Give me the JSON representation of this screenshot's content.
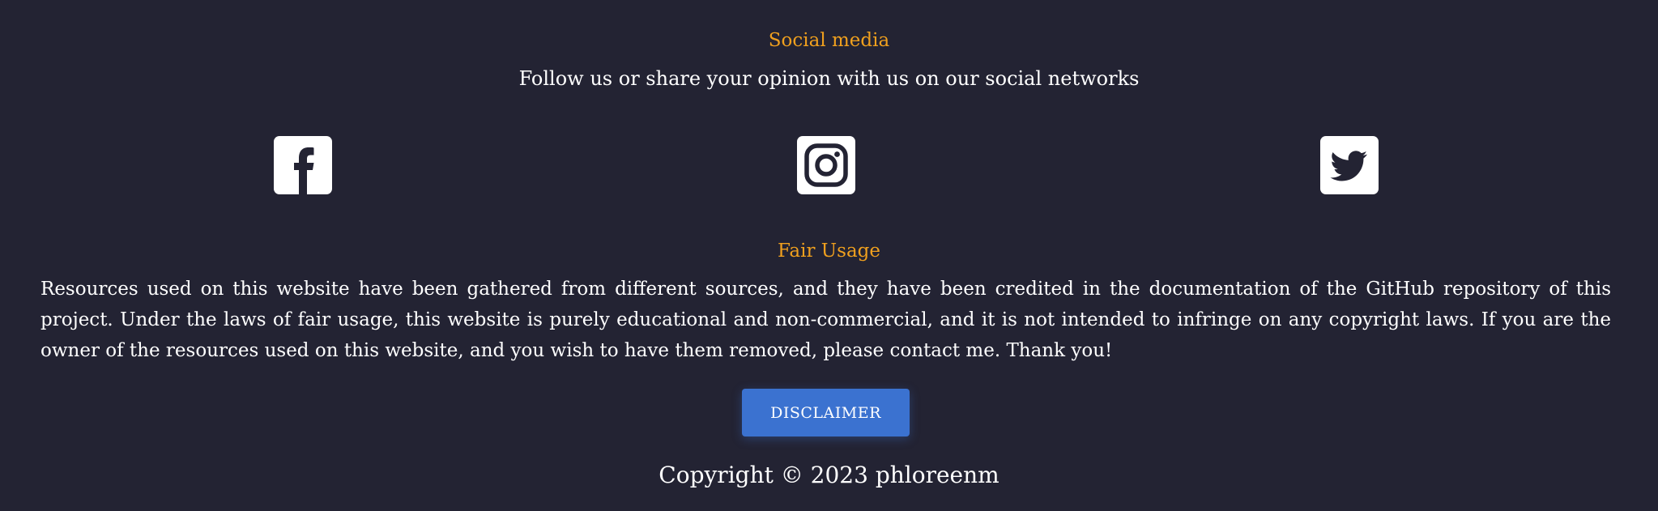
{
  "social": {
    "title": "Social media",
    "subtitle": "Follow us or share your opinion with us on our social networks",
    "links": [
      {
        "name": "Facebook",
        "icon": "facebook-icon"
      },
      {
        "name": "Instagram",
        "icon": "instagram-icon"
      },
      {
        "name": "Twitter",
        "icon": "twitter-icon"
      }
    ]
  },
  "fair_usage": {
    "title": "Fair Usage",
    "text": "Resources used on this website have been gathered from different sources, and they have been credited in the documentation of the GitHub repository of this project. Under the laws of fair usage, this website is purely educational and non-commercial, and it is not intended to infringe on any copyright laws. If you are the owner of the resources used on this website, and you wish to have them removed, please contact me. Thank you!"
  },
  "disclaimer_button": {
    "label": "DISCLAIMER"
  },
  "footer": {
    "copyright": "Copyright © 2023 phloreenm"
  },
  "colors": {
    "background": "#232333",
    "accent": "#f0a01e",
    "button": "#3b72d0",
    "text": "#ffffff"
  }
}
